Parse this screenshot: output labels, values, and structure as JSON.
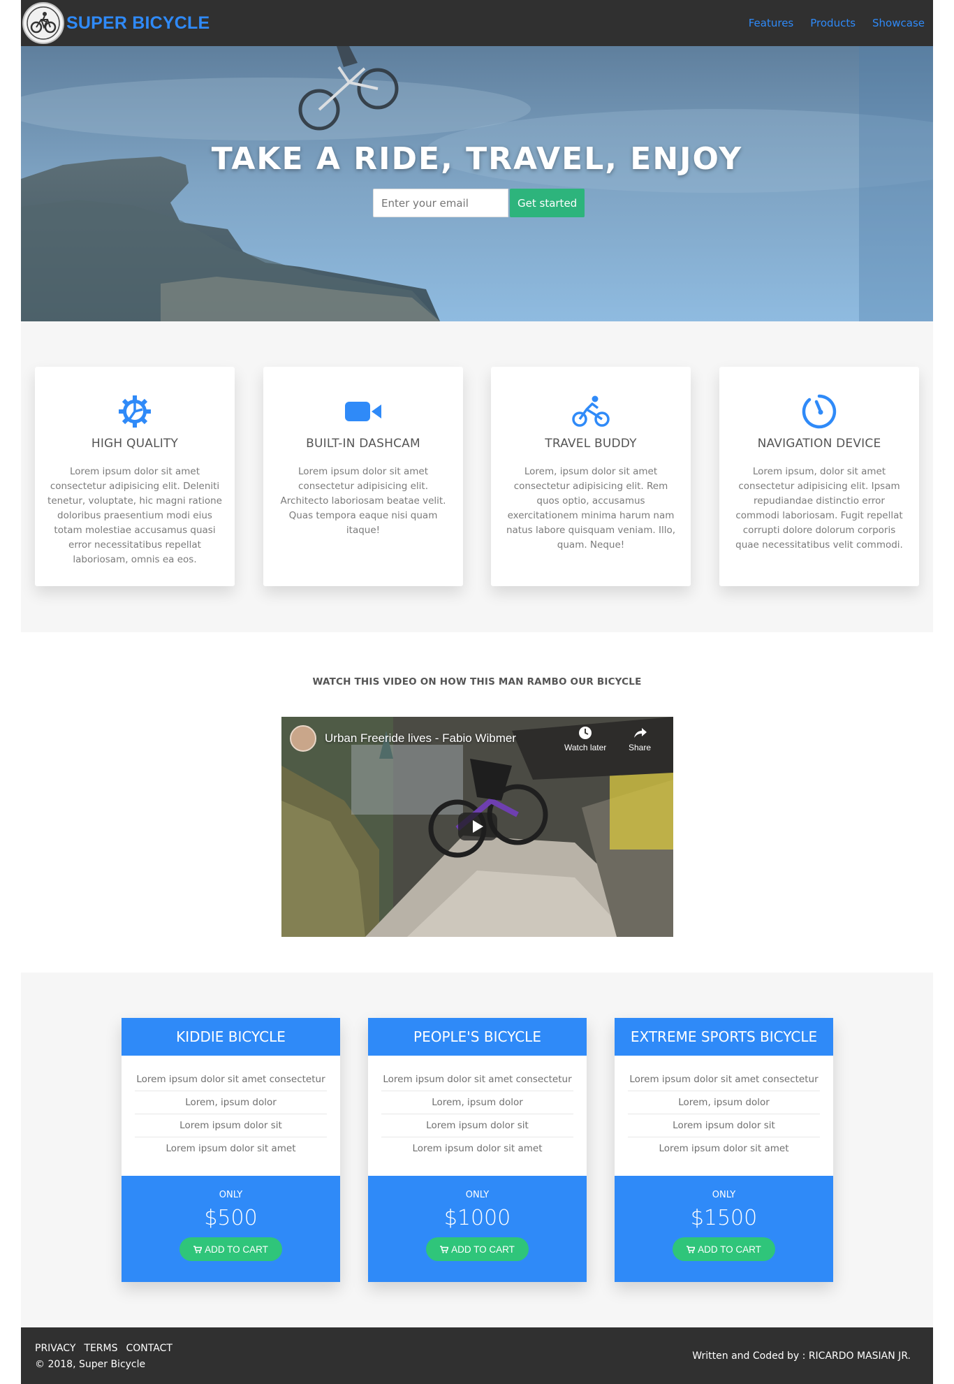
{
  "nav": {
    "brand": "SUPER BICYCLE",
    "logo_icon": "mountain-bike-logo",
    "links": [
      "Features",
      "Products",
      "Showcase"
    ]
  },
  "hero": {
    "title": "TAKE A RIDE, TRAVEL, ENJOY",
    "email_placeholder": "Enter your email",
    "cta_label": "Get started"
  },
  "features": [
    {
      "icon": "gear-icon",
      "title": "HIGH QUALITY",
      "text": "Lorem ipsum dolor sit amet consectetur adipisicing elit. Deleniti tenetur, voluptate, hic magni ratione doloribus praesentium modi eius totam molestiae accusamus quasi error necessitatibus repellat laboriosam, omnis ea eos."
    },
    {
      "icon": "video-camera-icon",
      "title": "BUILT-IN DASHCAM",
      "text": "Lorem ipsum dolor sit amet consectetur adipisicing elit. Architecto laboriosam beatae velit. Quas tempora eaque nisi quam itaque!"
    },
    {
      "icon": "bicycle-icon",
      "title": "TRAVEL BUDDY",
      "text": "Lorem, ipsum dolor sit amet consectetur adipisicing elit. Rem quos optio, accusamus exercitationem minima harum nam natus labore quisquam veniam. Illo, quam. Neque!"
    },
    {
      "icon": "stopwatch-icon",
      "title": "NAVIGATION DEVICE",
      "text": "Lorem ipsum, dolor sit amet consectetur adipisicing elit. Ipsam repudiandae distinctio error commodi laboriosam. Fugit repellat corrupti dolore dolorum corporis quae necessitatibus velit commodi."
    }
  ],
  "video": {
    "heading": "WATCH THIS VIDEO ON HOW THIS MAN RAMBO OUR BICYCLE",
    "title": "Urban Freeride lives - Fabio Wibmer",
    "watch_later": "Watch later",
    "share": "Share"
  },
  "pricing": [
    {
      "name": "KIDDIE BICYCLE",
      "features": [
        "Lorem ipsum dolor sit amet consectetur",
        "Lorem, ipsum dolor",
        "Lorem ipsum dolor sit",
        "Lorem ipsum dolor sit amet"
      ],
      "only": "ONLY",
      "price": "$500",
      "button": "ADD TO CART"
    },
    {
      "name": "PEOPLE'S BICYCLE",
      "features": [
        "Lorem ipsum dolor sit amet consectetur",
        "Lorem, ipsum dolor",
        "Lorem ipsum dolor sit",
        "Lorem ipsum dolor sit amet"
      ],
      "only": "ONLY",
      "price": "$1000",
      "button": "ADD TO CART"
    },
    {
      "name": "EXTREME SPORTS BICYCLE",
      "features": [
        "Lorem ipsum dolor sit amet consectetur",
        "Lorem, ipsum dolor",
        "Lorem ipsum dolor sit",
        "Lorem ipsum dolor sit amet"
      ],
      "only": "ONLY",
      "price": "$1500",
      "button": "ADD TO CART"
    }
  ],
  "footer": {
    "links": [
      "PRIVACY",
      "TERMS",
      "CONTACT"
    ],
    "copyright": "© 2018, Super Bicycle",
    "credit": "Written and Coded by : RICARDO MASIAN JR."
  },
  "colors": {
    "nav_bg": "#303030",
    "accent_blue": "#2f8af8",
    "cta_green": "#2db47c",
    "cart_green": "#2fc57a",
    "section_bg": "#f6f6f6"
  }
}
